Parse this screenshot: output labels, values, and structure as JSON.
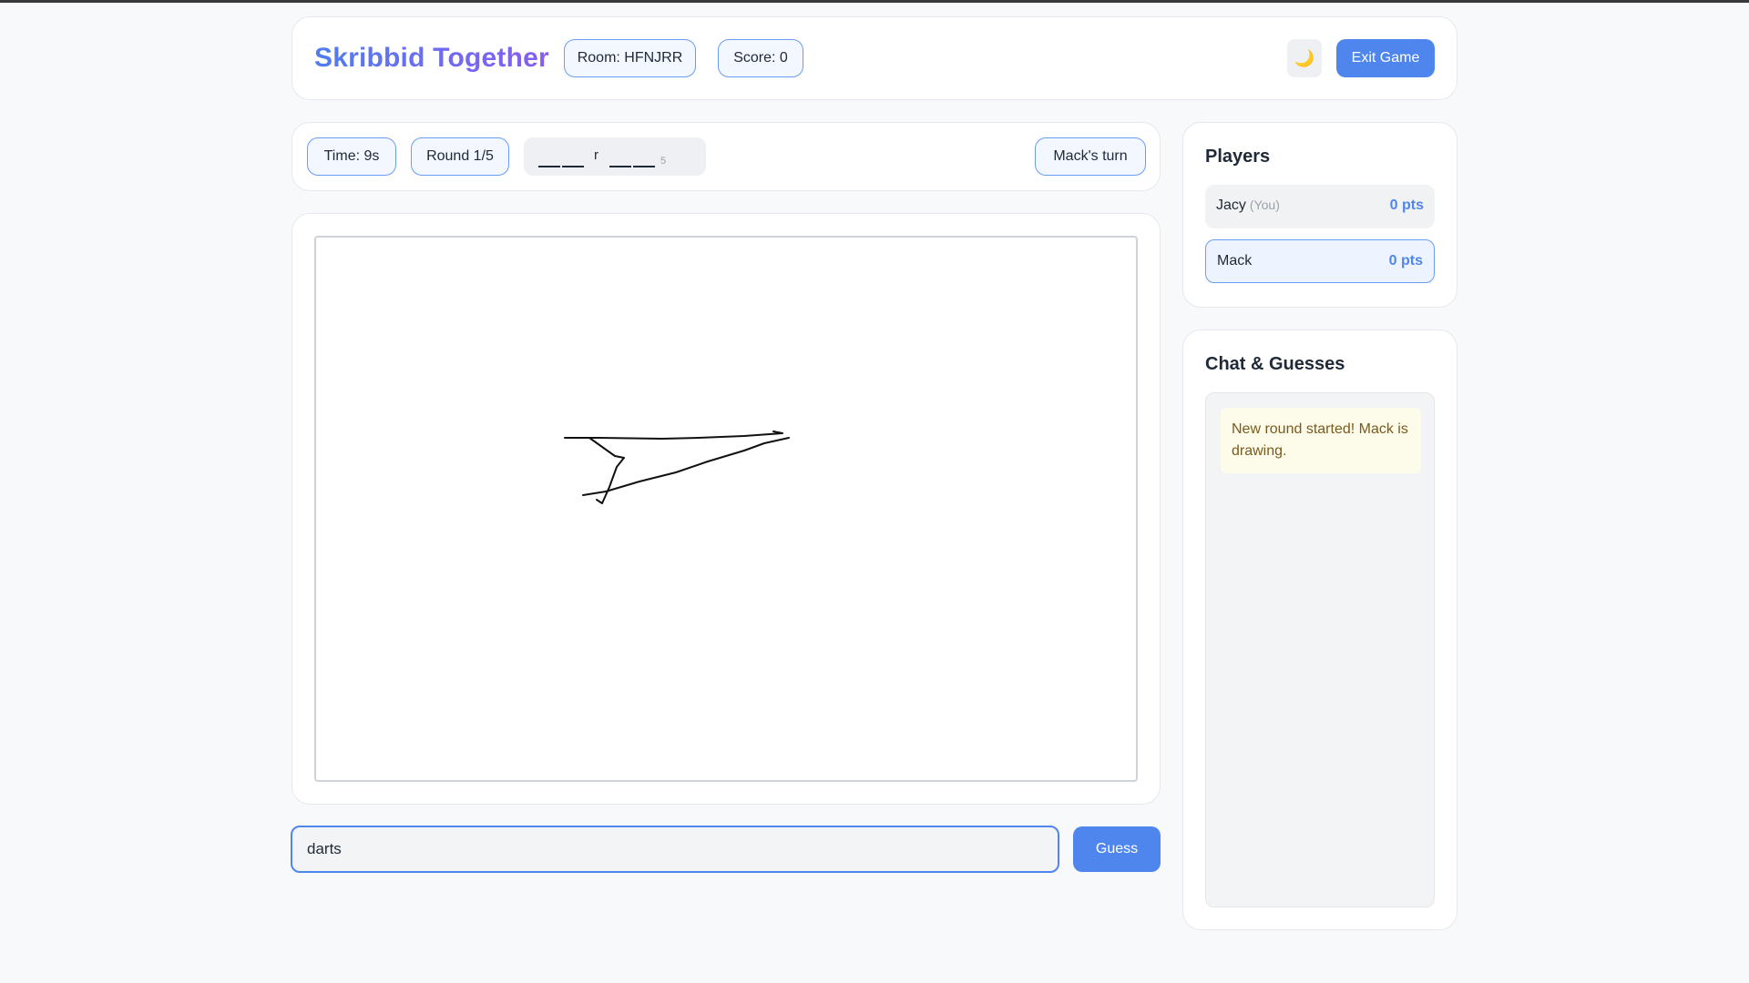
{
  "header": {
    "logo": "Skribbid Together",
    "room": "Room: HFNJRR",
    "score": "Score: 0",
    "theme_toggle_glyph": "🌙",
    "exit_label": "Exit Game"
  },
  "status": {
    "time": "Time: 9s",
    "round": "Round 1/5",
    "hint_letter": "r",
    "hint_length": "5",
    "turn": "Mack's turn"
  },
  "guess": {
    "value": "darts",
    "button_label": "Guess"
  },
  "players": {
    "title": "Players",
    "list": [
      {
        "name": "Jacy",
        "you_tag": "(You)",
        "points": "0 pts",
        "active": false
      },
      {
        "name": "Mack",
        "you_tag": "",
        "points": "0 pts",
        "active": true
      }
    ]
  },
  "chat": {
    "title": "Chat & Guesses",
    "messages": [
      {
        "type": "system",
        "text": "New round started! Mack is drawing."
      }
    ]
  },
  "colors": {
    "accent": "#4f86ee",
    "logo_gradient_start": "#4f7df0",
    "logo_gradient_end": "#8a5cf0",
    "stroke": "#111111"
  }
}
